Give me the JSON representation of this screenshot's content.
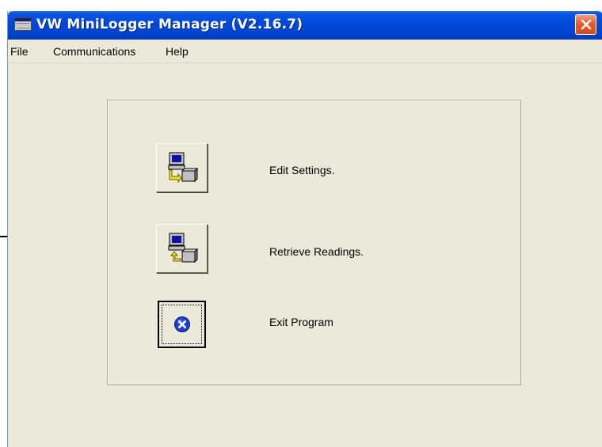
{
  "window": {
    "title": "VW MiniLogger Manager (V2.16.7)"
  },
  "menu": {
    "items": [
      "File",
      "Communications",
      "Help"
    ]
  },
  "actions": {
    "edit_settings": {
      "label": "Edit Settings.",
      "icon": "computer-to-logger-icon"
    },
    "retrieve_readings": {
      "label": "Retrieve Readings.",
      "icon": "logger-to-computer-icon"
    },
    "exit_program": {
      "label": "Exit Program",
      "icon": "exit-x-icon"
    }
  },
  "colors": {
    "titlebar": "#0047d8",
    "window_bg": "#ece9d8",
    "close_button": "#e45c2c"
  }
}
